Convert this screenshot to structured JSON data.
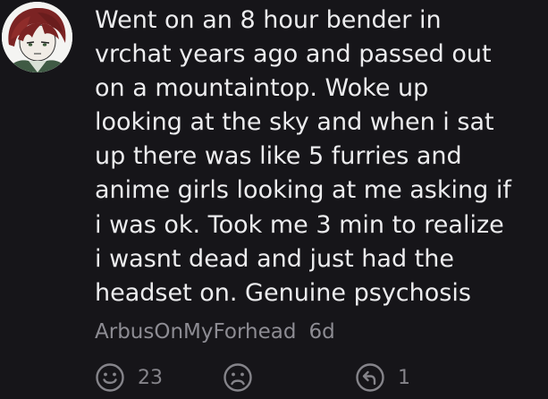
{
  "comment": {
    "lines": [
      "Went on an 8 hour bender in",
      "vrchat years ago and passed out",
      "on a mountaintop. Woke up",
      "looking at the sky and when i sat",
      "up there was like 5 furries and",
      "anime girls looking at me asking if",
      "i was ok. Took me 3 min to realize",
      "i wasnt dead and just had the",
      "headset on. Genuine psychosis"
    ],
    "author": "ArbusOnMyForhead",
    "age": "6d"
  },
  "actions": {
    "like_icon": "smile-face-icon",
    "like_count": "23",
    "dislike_icon": "frown-face-icon",
    "reply_icon": "reply-arrow-icon",
    "reply_count": "1"
  },
  "colors": {
    "background": "#161519",
    "text": "#ececee",
    "muted": "#8d8c93"
  }
}
